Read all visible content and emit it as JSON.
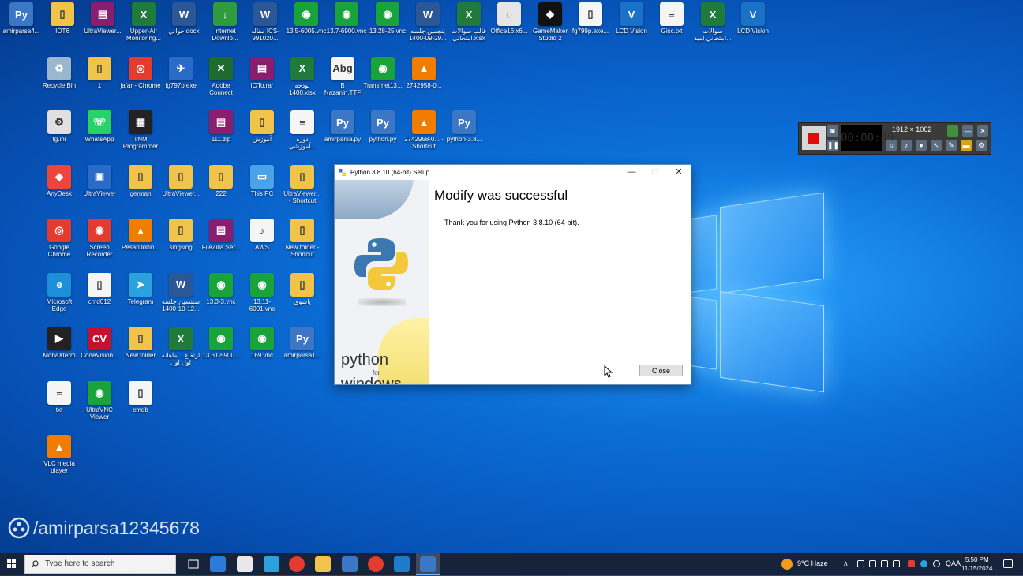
{
  "desktop": {
    "icons": [
      {
        "label": "amirparsa4...",
        "color": "#3b77c4",
        "glyph": "Py"
      },
      {
        "label": "IOT6",
        "color": "#f0c44a",
        "glyph": "▯"
      },
      {
        "label": "UltraViewer...",
        "color": "#8a1d6e",
        "glyph": "▤"
      },
      {
        "label": "Upper-Air Monitoring...",
        "color": "#1f7a3c",
        "glyph": "X"
      },
      {
        "label": "جواني.docx",
        "color": "#2b5797",
        "glyph": "W"
      },
      {
        "label": "Internet Downlo...",
        "color": "#2f9b3e",
        "glyph": "↓"
      },
      {
        "label": "مقاله ICS-991020...",
        "color": "#2b5797",
        "glyph": "W"
      },
      {
        "label": "13.5-6005.vnc",
        "color": "#18a33b",
        "glyph": "◉"
      },
      {
        "label": "13.7-6900.vnc",
        "color": "#18a33b",
        "glyph": "◉"
      },
      {
        "label": "13.28-25.vnc",
        "color": "#18a33b",
        "glyph": "◉"
      },
      {
        "label": "پنجمین جلسه 29-09-1400...",
        "color": "#2b5797",
        "glyph": "W"
      },
      {
        "label": "قالب سوالات امتحاني.xlsx",
        "color": "#1f7a3c",
        "glyph": "X"
      },
      {
        "label": "Office16.x6...",
        "color": "#e6e6e6",
        "glyph": "◌"
      },
      {
        "label": "GameMaker Studio 2",
        "color": "#111111",
        "glyph": "◆"
      },
      {
        "label": "fg799p.exe...",
        "color": "#f5f5f5",
        "glyph": "▯"
      },
      {
        "label": "LCD Vision",
        "color": "#1a72c8",
        "glyph": "V"
      },
      {
        "label": "Gisc.txt",
        "color": "#f5f5f5",
        "glyph": "≡"
      },
      {
        "label": "سوالات امتحاني امید...",
        "color": "#1f7a3c",
        "glyph": "X"
      },
      {
        "label": "LCD Vision",
        "color": "#1a72c8",
        "glyph": "V"
      },
      {
        "label": "Recycle Bin",
        "color": "#9bb7d0",
        "glyph": "♻"
      },
      {
        "label": "1",
        "color": "#f0c44a",
        "glyph": "▯"
      },
      {
        "label": "jafar - Chrome",
        "color": "#e33b2e",
        "glyph": "◎"
      },
      {
        "label": "fg797p.exe",
        "color": "#2a6ac8",
        "glyph": "✈"
      },
      {
        "label": "Adobe Connect",
        "color": "#1d6b2e",
        "glyph": "✕"
      },
      {
        "label": "IOTo.rar",
        "color": "#8a1d6e",
        "glyph": "▤"
      },
      {
        "label": "بودجه 1400.xlsx",
        "color": "#1f7a3c",
        "glyph": "X"
      },
      {
        "label": "B Nazanin.TTF",
        "color": "#f5f5f5",
        "glyph": "Abg"
      },
      {
        "label": "Transmet13...",
        "color": "#18a33b",
        "glyph": "◉"
      },
      {
        "label": "2742958-0...",
        "color": "#f07d00",
        "glyph": "▲"
      },
      {
        "label": "fg.ini",
        "color": "#e0e0e0",
        "glyph": "⚙"
      },
      {
        "label": "WhatsApp",
        "color": "#25d366",
        "glyph": "☏"
      },
      {
        "label": "TNM Programmer",
        "color": "#222222",
        "glyph": "▦"
      },
      {
        "label": "111.zip",
        "color": "#8a1d6e",
        "glyph": "▤"
      },
      {
        "label": "آموزش",
        "color": "#f0c44a",
        "glyph": "▯"
      },
      {
        "label": "دوره آموزشي...",
        "color": "#f5f5f5",
        "glyph": "≡"
      },
      {
        "label": "amirparsa.py",
        "color": "#3b77c4",
        "glyph": "Py"
      },
      {
        "label": "python.py",
        "color": "#3b77c4",
        "glyph": "Py"
      },
      {
        "label": "2742958-0... - Shortcut",
        "color": "#f07d00",
        "glyph": "▲"
      },
      {
        "label": "python-3.8...",
        "color": "#3b77c4",
        "glyph": "Py"
      },
      {
        "label": "AnyDesk",
        "color": "#ef443b",
        "glyph": "◆"
      },
      {
        "label": "UltraViewer",
        "color": "#2a6ac8",
        "glyph": "▣"
      },
      {
        "label": "german",
        "color": "#f0c44a",
        "glyph": "▯"
      },
      {
        "label": "UltraViewer...",
        "color": "#f0c44a",
        "glyph": "▯"
      },
      {
        "label": "222",
        "color": "#f0c44a",
        "glyph": "▯"
      },
      {
        "label": "This PC",
        "color": "#4aa3e8",
        "glyph": "▭"
      },
      {
        "label": "UltraViewer... - Shortcut",
        "color": "#f0c44a",
        "glyph": "▯"
      },
      {
        "label": "Google Chrome",
        "color": "#e33b2e",
        "glyph": "◎"
      },
      {
        "label": "Screen Recorder",
        "color": "#e33b2e",
        "glyph": "◉"
      },
      {
        "label": "PesarDolfin...",
        "color": "#f07d00",
        "glyph": "▲"
      },
      {
        "label": "singsing",
        "color": "#f0c44a",
        "glyph": "▯"
      },
      {
        "label": "FileZilla Ser...",
        "color": "#8a1d6e",
        "glyph": "▤"
      },
      {
        "label": "AWS",
        "color": "#f5f5f5",
        "glyph": "♪"
      },
      {
        "label": "New folder - Shortcut",
        "color": "#f0c44a",
        "glyph": "▯"
      },
      {
        "label": "Microsoft Edge",
        "color": "#1d8fd8",
        "glyph": "e"
      },
      {
        "label": "cmd012",
        "color": "#f5f5f5",
        "glyph": "▯"
      },
      {
        "label": "Telegram",
        "color": "#2aa2dd",
        "glyph": "➤"
      },
      {
        "label": "ششمين جلسه 12-10-1400...",
        "color": "#2b5797",
        "glyph": "W"
      },
      {
        "label": "13.3-3.vnc",
        "color": "#18a33b",
        "glyph": "◉"
      },
      {
        "label": "13.11-6001.vnc",
        "color": "#18a33b",
        "glyph": "◉"
      },
      {
        "label": "پاشوي",
        "color": "#f0c44a",
        "glyph": "▯"
      },
      {
        "label": "MobaXterm",
        "color": "#222222",
        "glyph": "▶"
      },
      {
        "label": "CodeVision...",
        "color": "#c8102e",
        "glyph": "CV"
      },
      {
        "label": "New folder",
        "color": "#f0c44a",
        "glyph": "▯"
      },
      {
        "label": "ارتفاع... ماهانه اول اول",
        "color": "#1f7a3c",
        "glyph": "X"
      },
      {
        "label": "13.61-5900...",
        "color": "#18a33b",
        "glyph": "◉"
      },
      {
        "label": "169.vnc",
        "color": "#18a33b",
        "glyph": "◉"
      },
      {
        "label": "amirparsa1...",
        "color": "#3b77c4",
        "glyph": "Py"
      },
      {
        "label": "txt",
        "color": "#f5f5f5",
        "glyph": "≡"
      },
      {
        "label": "UltraVNC Viewer",
        "color": "#18a33b",
        "glyph": "◉"
      },
      {
        "label": "cmdb",
        "color": "#f5f5f5",
        "glyph": "▯"
      },
      {
        "label": "VLC media player",
        "color": "#f07d00",
        "glyph": "▲"
      }
    ]
  },
  "dialog": {
    "title": "Python 3.8.10 (64-bit) Setup",
    "headline": "Modify was successful",
    "message": "Thank you for using Python 3.8.10 (64-bit).",
    "close_label": "Close",
    "minimize": "—",
    "maximize": "□",
    "close_x": "✕",
    "side_python": "python",
    "side_for": "for",
    "side_windows": "windows"
  },
  "recorder": {
    "timer": "00:00:49",
    "resolution": "1912 × 1062"
  },
  "watermark": {
    "text": "/amirparsa12345678"
  },
  "taskbar": {
    "search_placeholder": "Type here to search",
    "weather": "9°C  Haze",
    "language": "QAA",
    "time": "5:50 PM",
    "date": "11/15/2024"
  },
  "colors": {
    "accent": "#0b6fd8",
    "taskbar": "#16233a",
    "record_red": "#e30b0b"
  }
}
